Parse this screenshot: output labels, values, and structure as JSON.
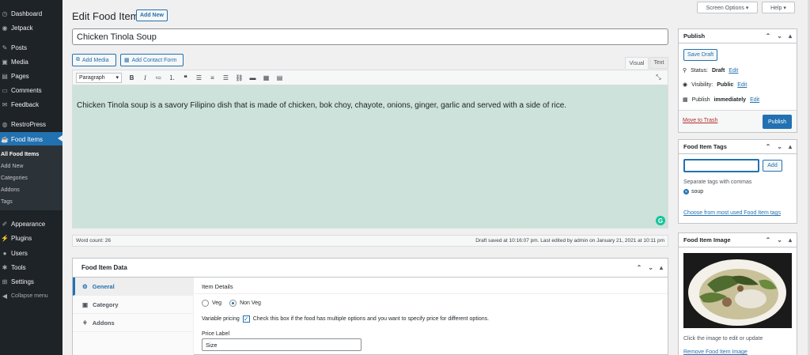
{
  "sidebar": {
    "items": [
      {
        "label": "Dashboard",
        "icon": "dashboard-icon"
      },
      {
        "label": "Jetpack",
        "icon": "jetpack-icon"
      },
      {
        "label": "Posts",
        "icon": "pin-icon"
      },
      {
        "label": "Media",
        "icon": "media-icon"
      },
      {
        "label": "Pages",
        "icon": "pages-icon"
      },
      {
        "label": "Comments",
        "icon": "comments-icon"
      },
      {
        "label": "Feedback",
        "icon": "feedback-icon"
      },
      {
        "label": "RestroPress",
        "icon": "restropress-icon"
      },
      {
        "label": "Food Items",
        "icon": "food-icon"
      },
      {
        "label": "Appearance",
        "icon": "appearance-icon"
      },
      {
        "label": "Plugins",
        "icon": "plugins-icon"
      },
      {
        "label": "Users",
        "icon": "users-icon"
      },
      {
        "label": "Tools",
        "icon": "tools-icon"
      },
      {
        "label": "Settings",
        "icon": "settings-icon"
      },
      {
        "label": "Collapse menu",
        "icon": "collapse-icon"
      }
    ],
    "submenu": [
      "All Food Items",
      "Add New",
      "Categories",
      "Addons",
      "Tags"
    ]
  },
  "top": {
    "screen_options": "Screen Options ▾",
    "help": "Help ▾"
  },
  "header": {
    "title": "Edit Food Item",
    "add_new": "Add New"
  },
  "post_title": "Chicken Tinola Soup",
  "editor": {
    "add_media": "Add Media",
    "add_contact_form": "Add Contact Form",
    "tab_visual": "Visual",
    "tab_text": "Text",
    "format": "Paragraph",
    "content": "Chicken Tinola soup is a savory Filipino dish that is made of chicken, bok choy, chayote, onions, ginger, garlic and served with a side of rice.",
    "word_count": "Word count: 26",
    "draft_saved": "Draft saved at 10:16:07 pm. Last edited by admin on January 21, 2021 at 10:11 pm",
    "grammarly": "G"
  },
  "food_data": {
    "title": "Food Item Data",
    "tabs": [
      "General",
      "Category",
      "Addons"
    ],
    "item_details": "Item Details",
    "veg": "Veg",
    "non_veg": "Non Veg",
    "variable_pricing": "Variable pricing",
    "variable_pricing_desc": "Check this box if the food has multiple options and you want to specify price for different options.",
    "price_label": "Price Label",
    "price_value": "Size"
  },
  "publish": {
    "title": "Publish",
    "save_draft": "Save Draft",
    "status_label": "Status:",
    "status_value": "Draft",
    "visibility_label": "Visibility:",
    "visibility_value": "Public",
    "publish_label": "Publish",
    "publish_value": "immediately",
    "edit": "Edit",
    "move_to_trash": "Move to Trash",
    "publish_button": "Publish"
  },
  "tags": {
    "title": "Food Item Tags",
    "add": "Add",
    "hint": "Separate tags with commas",
    "tag": "soup",
    "choose": "Choose from most used Food Item tags"
  },
  "image": {
    "title": "Food Item Image",
    "hint": "Click the image to edit or update",
    "remove": "Remove Food Item Image"
  },
  "colors": {
    "sidebar": "#1d2327",
    "accent": "#2271b1",
    "editor_bg": "#cde2da",
    "trash": "#b32d2e"
  }
}
